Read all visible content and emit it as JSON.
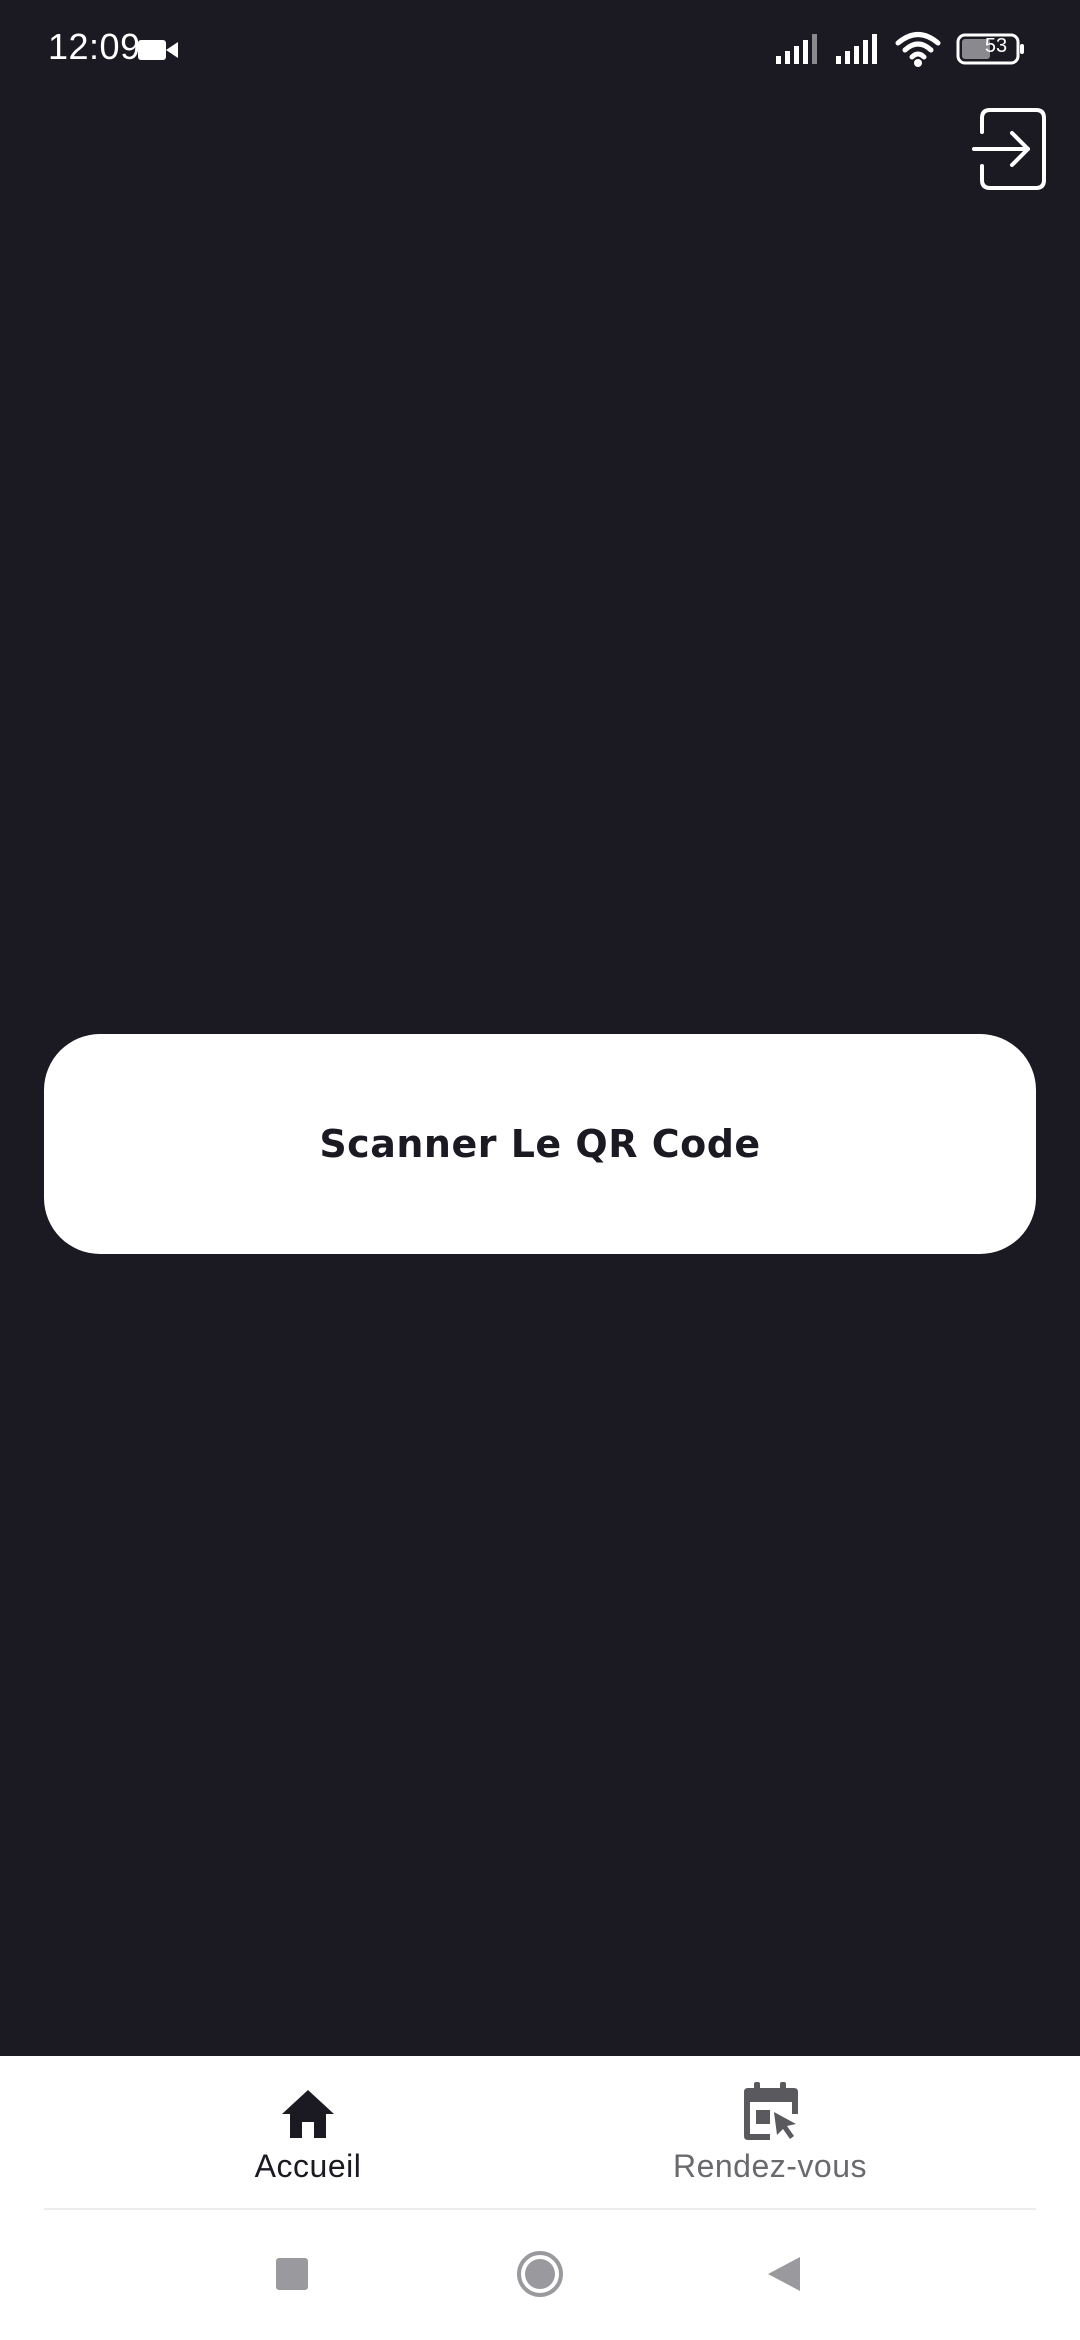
{
  "status_bar": {
    "time": "12:09",
    "battery_level": "53",
    "icons": [
      "video-camera-icon",
      "cell-signal-icon",
      "cell-signal-icon",
      "wifi-icon",
      "battery-icon"
    ]
  },
  "header": {
    "logout_icon": "exit-icon"
  },
  "main": {
    "scan_button_label": "Scanner Le QR Code"
  },
  "bottom_nav": {
    "items": [
      {
        "label": "Accueil",
        "icon": "home-icon",
        "active": true
      },
      {
        "label": "Rendez-vous",
        "icon": "calendar-icon",
        "active": false
      }
    ]
  },
  "system_nav": {
    "icons": [
      "recent-apps-icon",
      "home-circle-icon",
      "back-icon"
    ]
  },
  "colors": {
    "background": "#1b1922",
    "surface": "#ffffff",
    "active_text": "#1b1922",
    "inactive_text": "#6a6a6e"
  }
}
